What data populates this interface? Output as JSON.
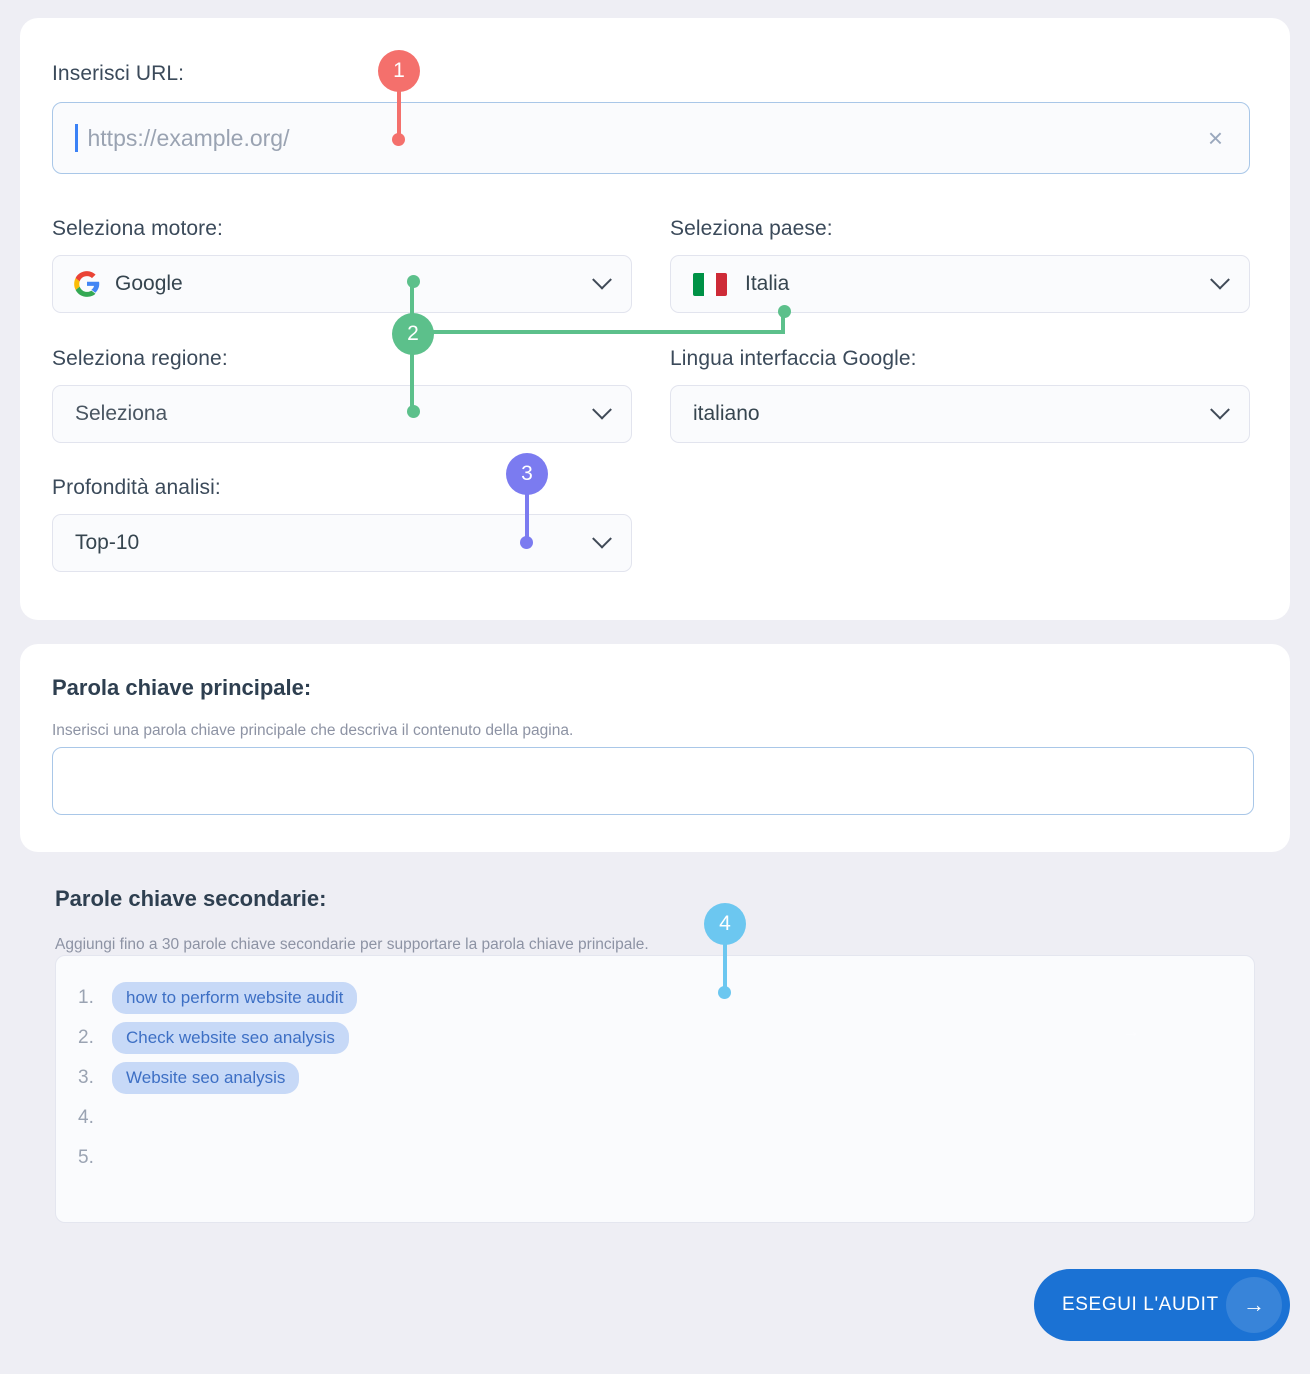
{
  "url_field": {
    "label": "Inserisci URL:",
    "value": "",
    "placeholder": "https://example.org/",
    "clear_icon": "close-icon"
  },
  "engine": {
    "label": "Seleziona motore:",
    "value": "Google",
    "icon": "google-logo-icon"
  },
  "country": {
    "label": "Seleziona paese:",
    "value": "Italia",
    "icon": "italy-flag-icon"
  },
  "region": {
    "label": "Seleziona regione:",
    "value": "Seleziona"
  },
  "interface_language": {
    "label": "Lingua interfaccia Google:",
    "value": "italiano"
  },
  "depth": {
    "label": "Profondità analisi:",
    "value": "Top-10"
  },
  "primary_keyword": {
    "title": "Parola chiave principale:",
    "description": "Inserisci una parola chiave principale che descriva il contenuto della pagina.",
    "value": ""
  },
  "secondary_keywords": {
    "title": "Parole chiave secondarie:",
    "description": "Aggiungi fino a 30 parole chiave secondarie per supportare la parola chiave principale.",
    "items": [
      {
        "num": "1.",
        "text": "how to perform website audit"
      },
      {
        "num": "2.",
        "text": "Check website seo analysis"
      },
      {
        "num": "3.",
        "text": "Website seo analysis"
      },
      {
        "num": "4.",
        "text": ""
      },
      {
        "num": "5.",
        "text": ""
      }
    ]
  },
  "submit": {
    "label": "ESEGUI L'AUDIT",
    "arrow": "→"
  },
  "annotations": [
    {
      "number": "1",
      "color": "#f4706c"
    },
    {
      "number": "2",
      "color": "#5cc08b"
    },
    {
      "number": "3",
      "color": "#7b7bf0"
    },
    {
      "number": "4",
      "color": "#6cc7f0"
    }
  ],
  "colors": {
    "page_background": "#eeeef4",
    "card_background": "#ffffff",
    "accent_blue": "#1b72d4",
    "chip_background": "#c7d9f7",
    "chip_text": "#3d6fc4",
    "input_border": "#a9c7e8"
  }
}
